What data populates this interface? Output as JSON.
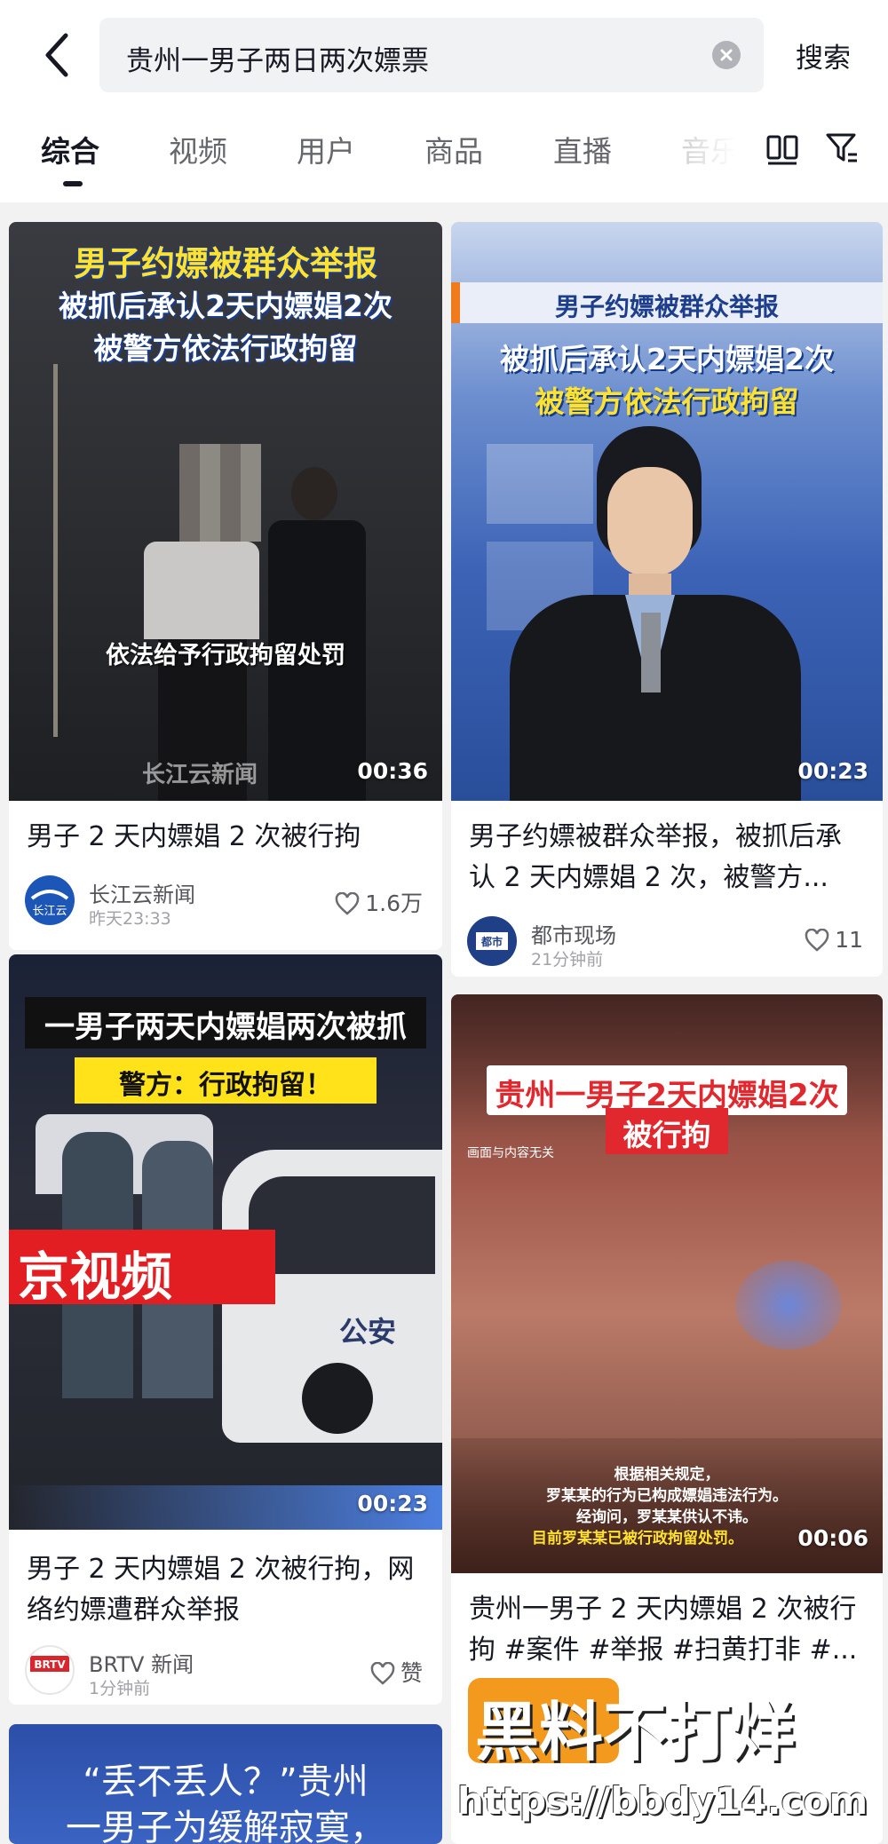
{
  "search": {
    "query": "贵州一男子两日两次嫖票",
    "button_label": "搜索"
  },
  "tabs": [
    "综合",
    "视频",
    "用户",
    "商品",
    "直播",
    "音乐"
  ],
  "cards": [
    {
      "overlay_lines": [
        "男子约嫖被群众举报",
        "被抓后承认2天内嫖娼2次",
        "被警方依法行政拘留"
      ],
      "caption": "依法给予行政拘留处罚",
      "source_mark": "长江云新闻",
      "duration": "00:36",
      "title": "男子 2 天内嫖娼 2 次被行拘",
      "author": "长江云新闻",
      "avatar_text": "长江云",
      "time": "昨天23:33",
      "likes": "1.6万"
    },
    {
      "overlay_lines": [
        "男子约嫖被群众举报",
        "被抓后承认2天内嫖娼2次",
        "被警方依法行政拘留"
      ],
      "duration": "00:23",
      "title": "男子约嫖被群众举报，被抓后承认 2 天内嫖娼 2 次，被警方...",
      "author": "都市现场",
      "avatar_text": "都市",
      "time": "21分钟前",
      "likes": "11"
    },
    {
      "overlay_lines": [
        "一男子两天内嫖娼两次被抓",
        "警方：行政拘留！"
      ],
      "brand": "京视频",
      "car_text": "公安",
      "duration": "00:23",
      "title": "男子 2 天内嫖娼 2 次被行拘，网络约嫖遭群众举报",
      "author": "BRTV 新闻",
      "avatar_text": "BRTV",
      "time": "1分钟前",
      "likes": "赞"
    },
    {
      "overlay_lines": [
        "贵州一男子2天内嫖娼2次",
        "被行拘"
      ],
      "disclaimer": "画面与内容无关",
      "sub_lines": [
        "根据相关规定，",
        "罗某某的行为已构成嫖娼违法行为。",
        "经询问，罗某某供认不讳。",
        "目前罗某某已被行政拘留处罚。"
      ],
      "duration": "00:06",
      "title": "贵州一男子 2 天内嫖娼 2 次被行拘 #案件 #举报 #扫黄打非 #...",
      "author": "",
      "time": "",
      "likes": ""
    },
    {
      "overlay_lines": [
        "“丢不丢人？”贵州",
        "一男子为缓解寂寞，"
      ]
    }
  ],
  "watermark": {
    "text": "黑料不打烊",
    "url": "https://bbdy14.com"
  },
  "colors": {
    "accent": "#fe2c55",
    "title_text": "#161823",
    "tab_inactive": "#66676c",
    "watermark_orange": "#f39a1e"
  }
}
